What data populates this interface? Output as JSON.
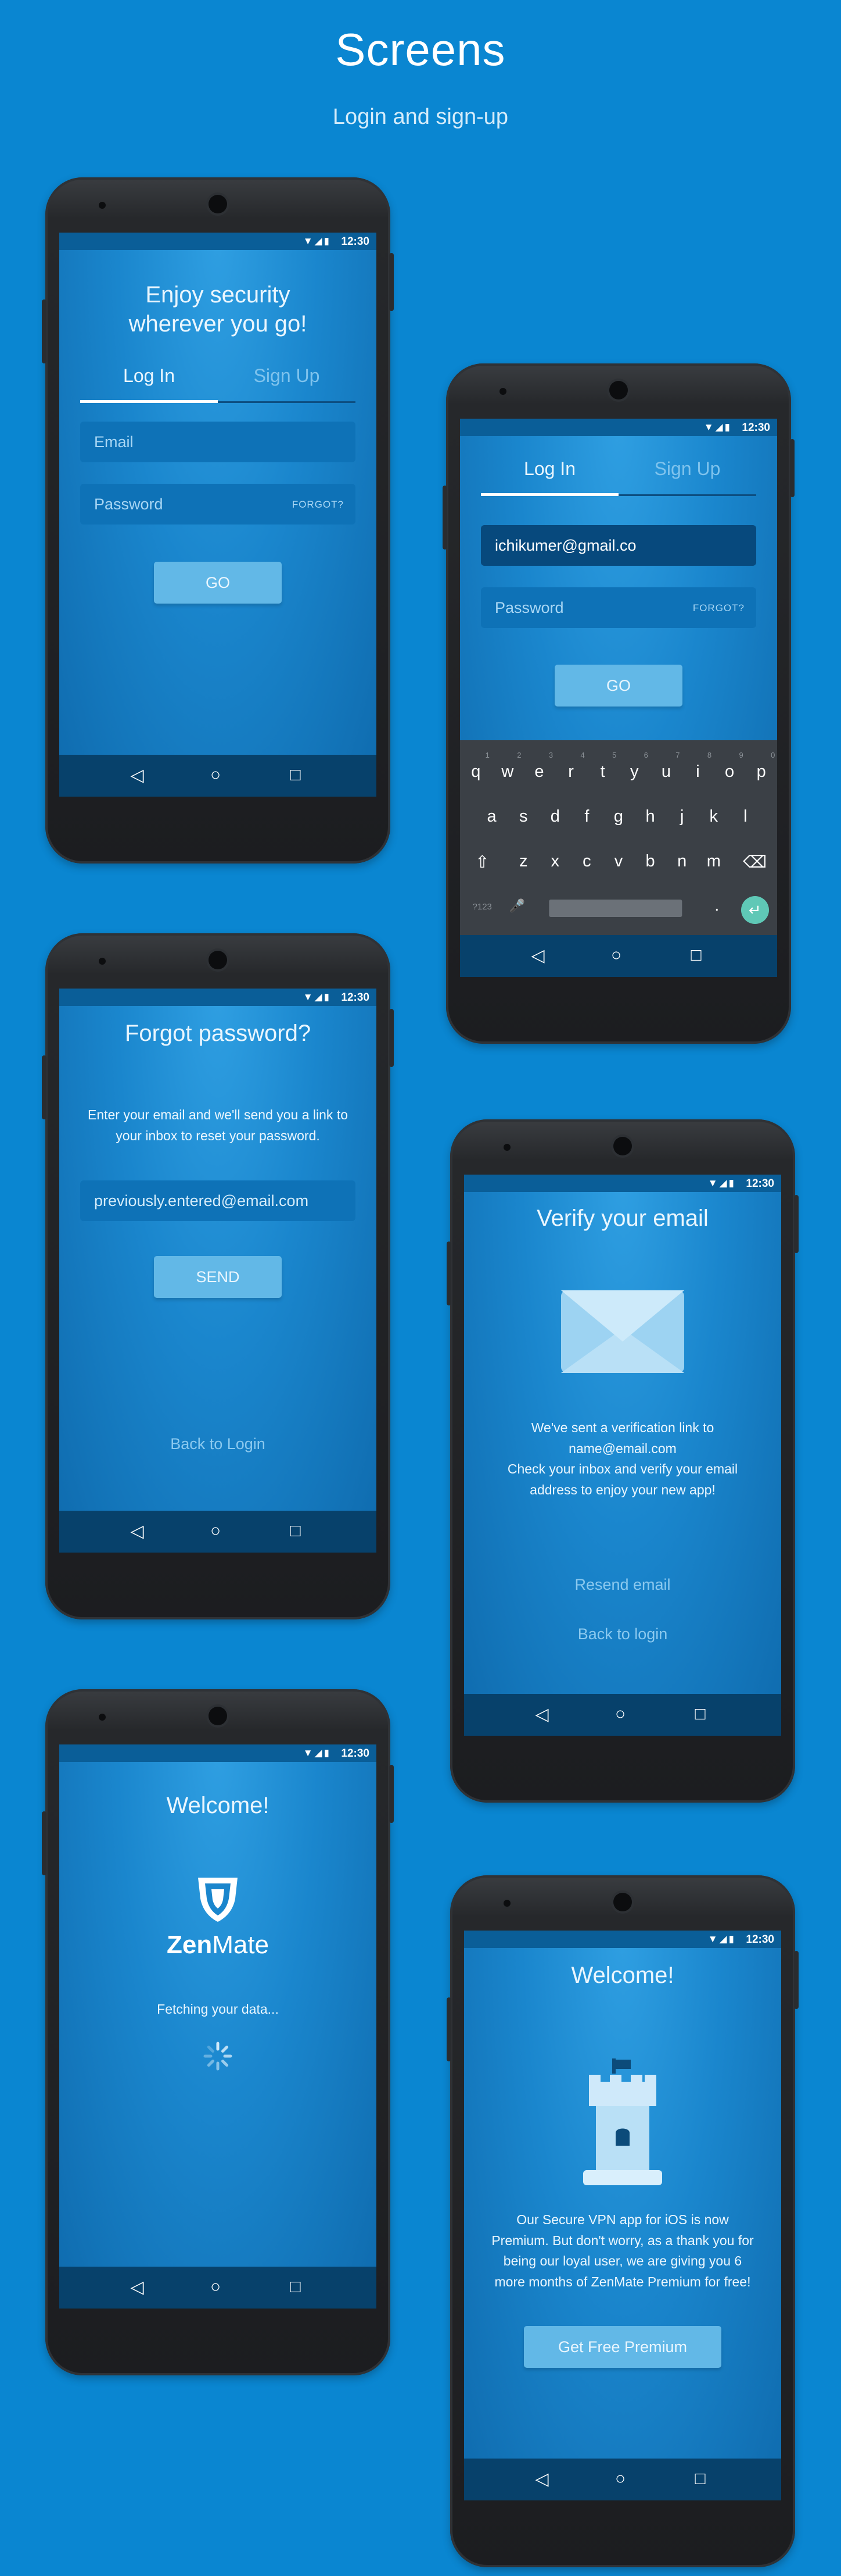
{
  "page": {
    "title": "Screens",
    "subtitle": "Login and sign-up"
  },
  "status": {
    "time": "12:30",
    "icons": "▼◢▮"
  },
  "nav": {
    "back": "◁",
    "home": "○",
    "recent": "□"
  },
  "login": {
    "headline_1": "Enjoy security",
    "headline_2": "wherever you go!",
    "tab_login": "Log In",
    "tab_signup": "Sign Up",
    "email_placeholder": "Email",
    "password_placeholder": "Password",
    "forgot": "FORGOT?",
    "go": "GO"
  },
  "login_typing": {
    "tab_login": "Log In",
    "tab_signup": "Sign Up",
    "email_value": "ichikumer@gmail.co",
    "password_placeholder": "Password",
    "forgot": "FORGOT?",
    "go": "GO"
  },
  "keyboard": {
    "row1": [
      "q",
      "w",
      "e",
      "r",
      "t",
      "y",
      "u",
      "i",
      "o",
      "p"
    ],
    "row1_hints": [
      "1",
      "2",
      "3",
      "4",
      "5",
      "6",
      "7",
      "8",
      "9",
      "0"
    ],
    "row2": [
      "a",
      "s",
      "d",
      "f",
      "g",
      "h",
      "j",
      "k",
      "l"
    ],
    "row3": [
      "z",
      "x",
      "c",
      "v",
      "b",
      "n",
      "m"
    ],
    "shift": "⇧",
    "backspace": "⌫",
    "numbers": "?123",
    "mic": "🎤",
    "period": ".",
    "enter": "↵"
  },
  "forgot_password": {
    "title": "Forgot password?",
    "text_1": "Enter your email and we'll send you a link to",
    "text_2": "your inbox to reset your password.",
    "email_value": "previously.entered@email.com",
    "send": "SEND",
    "back": "Back to Login"
  },
  "verify": {
    "title": "Verify your email",
    "line_1": "We've sent a verification link to",
    "line_2": "name@email.com",
    "line_3": "Check your inbox and verify your email",
    "line_4": "address to enjoy your new app!",
    "resend": "Resend email",
    "back": "Back to login"
  },
  "welcome_loading": {
    "title": "Welcome!",
    "brand_bold": "Zen",
    "brand_light": "Mate",
    "fetching": "Fetching your data..."
  },
  "welcome_premium": {
    "title": "Welcome!",
    "line_1": "Our Secure VPN app for iOS is now",
    "line_2": "Premium. But don't worry, as a thank you for",
    "line_3": "being our loyal user, we are giving you 6",
    "line_4": "more months of ZenMate Premium for free!",
    "cta": "Get Free Premium"
  },
  "colors": {
    "background": "#0a86d1",
    "navbar": "#07416b",
    "button": "#62b8e7",
    "enter_key": "#5fc8b6"
  }
}
